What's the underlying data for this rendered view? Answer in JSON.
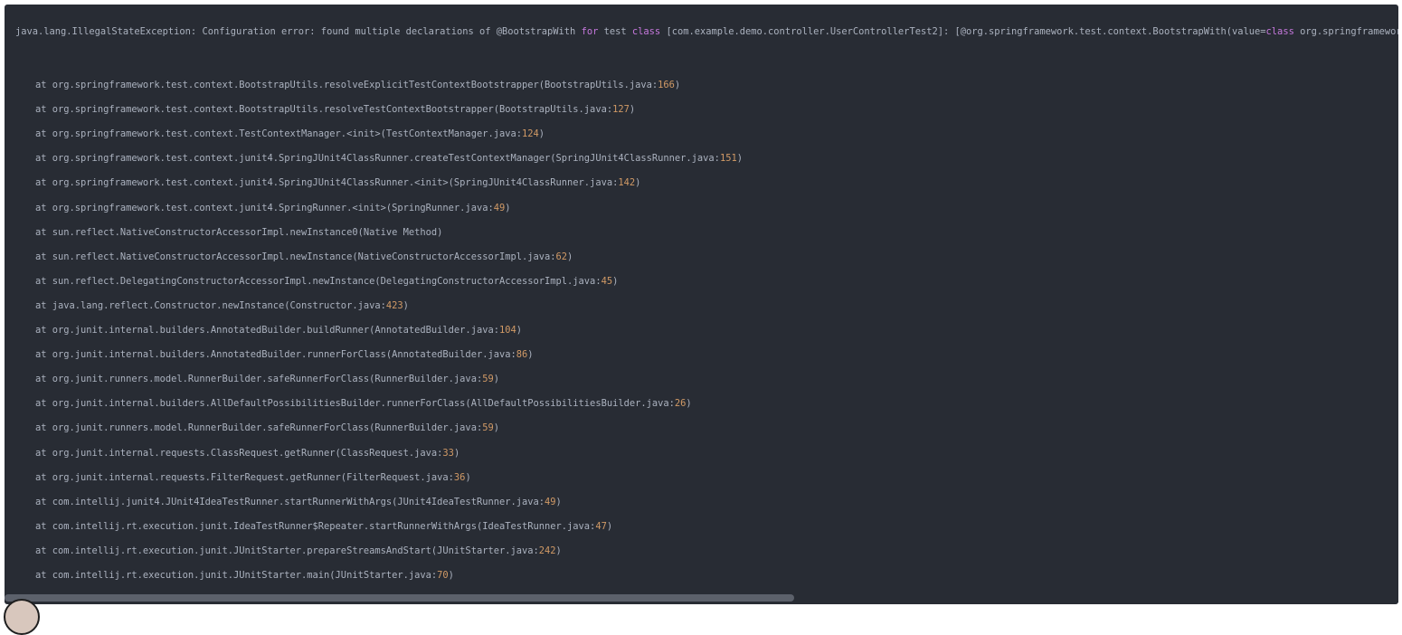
{
  "exception_line": {
    "prefix": "java.lang.IllegalStateException: Configuration error: found multiple declarations of @BootstrapWith ",
    "kw1": "for",
    "middle": " test ",
    "kw2": "class",
    "after_class": " [com.example.demo.controller.UserControllerTest2]: [@org.springframework.test.context.BootstrapWith(value=",
    "kw3": "class",
    "tail": " org.springframework.boot.tes"
  },
  "stack_frames": [
    {
      "text": "at org.springframework.test.context.BootstrapUtils.resolveExplicitTestContextBootstrapper(BootstrapUtils.java:",
      "line": "166",
      "close": ")"
    },
    {
      "text": "at org.springframework.test.context.BootstrapUtils.resolveTestContextBootstrapper(BootstrapUtils.java:",
      "line": "127",
      "close": ")"
    },
    {
      "text": "at org.springframework.test.context.TestContextManager.<init>(TestContextManager.java:",
      "line": "124",
      "close": ")"
    },
    {
      "text": "at org.springframework.test.context.junit4.SpringJUnit4ClassRunner.createTestContextManager(SpringJUnit4ClassRunner.java:",
      "line": "151",
      "close": ")"
    },
    {
      "text": "at org.springframework.test.context.junit4.SpringJUnit4ClassRunner.<init>(SpringJUnit4ClassRunner.java:",
      "line": "142",
      "close": ")"
    },
    {
      "text": "at org.springframework.test.context.junit4.SpringRunner.<init>(SpringRunner.java:",
      "line": "49",
      "close": ")"
    },
    {
      "text": "at sun.reflect.NativeConstructorAccessorImpl.newInstance0(Native Method)",
      "line": "",
      "close": ""
    },
    {
      "text": "at sun.reflect.NativeConstructorAccessorImpl.newInstance(NativeConstructorAccessorImpl.java:",
      "line": "62",
      "close": ")"
    },
    {
      "text": "at sun.reflect.DelegatingConstructorAccessorImpl.newInstance(DelegatingConstructorAccessorImpl.java:",
      "line": "45",
      "close": ")"
    },
    {
      "text": "at java.lang.reflect.Constructor.newInstance(Constructor.java:",
      "line": "423",
      "close": ")"
    },
    {
      "text": "at org.junit.internal.builders.AnnotatedBuilder.buildRunner(AnnotatedBuilder.java:",
      "line": "104",
      "close": ")"
    },
    {
      "text": "at org.junit.internal.builders.AnnotatedBuilder.runnerForClass(AnnotatedBuilder.java:",
      "line": "86",
      "close": ")"
    },
    {
      "text": "at org.junit.runners.model.RunnerBuilder.safeRunnerForClass(RunnerBuilder.java:",
      "line": "59",
      "close": ")"
    },
    {
      "text": "at org.junit.internal.builders.AllDefaultPossibilitiesBuilder.runnerForClass(AllDefaultPossibilitiesBuilder.java:",
      "line": "26",
      "close": ")"
    },
    {
      "text": "at org.junit.runners.model.RunnerBuilder.safeRunnerForClass(RunnerBuilder.java:",
      "line": "59",
      "close": ")"
    },
    {
      "text": "at org.junit.internal.requests.ClassRequest.getRunner(ClassRequest.java:",
      "line": "33",
      "close": ")"
    },
    {
      "text": "at org.junit.internal.requests.FilterRequest.getRunner(FilterRequest.java:",
      "line": "36",
      "close": ")"
    },
    {
      "text": "at com.intellij.junit4.JUnit4IdeaTestRunner.startRunnerWithArgs(JUnit4IdeaTestRunner.java:",
      "line": "49",
      "close": ")"
    },
    {
      "text": "at com.intellij.rt.execution.junit.IdeaTestRunner$Repeater.startRunnerWithArgs(IdeaTestRunner.java:",
      "line": "47",
      "close": ")"
    },
    {
      "text": "at com.intellij.rt.execution.junit.JUnitStarter.prepareStreamsAndStart(JUnitStarter.java:",
      "line": "242",
      "close": ")"
    },
    {
      "text": "at com.intellij.rt.execution.junit.JUnitStarter.main(JUnitStarter.java:",
      "line": "70",
      "close": ")"
    }
  ],
  "colors": {
    "background": "#282c34",
    "text": "#abb2bf",
    "keyword": "#c678dd",
    "number": "#d19a66",
    "scroll_thumb": "#5c616b"
  },
  "scrollbar": {
    "horizontal_position_fraction": 0.0,
    "visible_fraction": 0.57
  }
}
